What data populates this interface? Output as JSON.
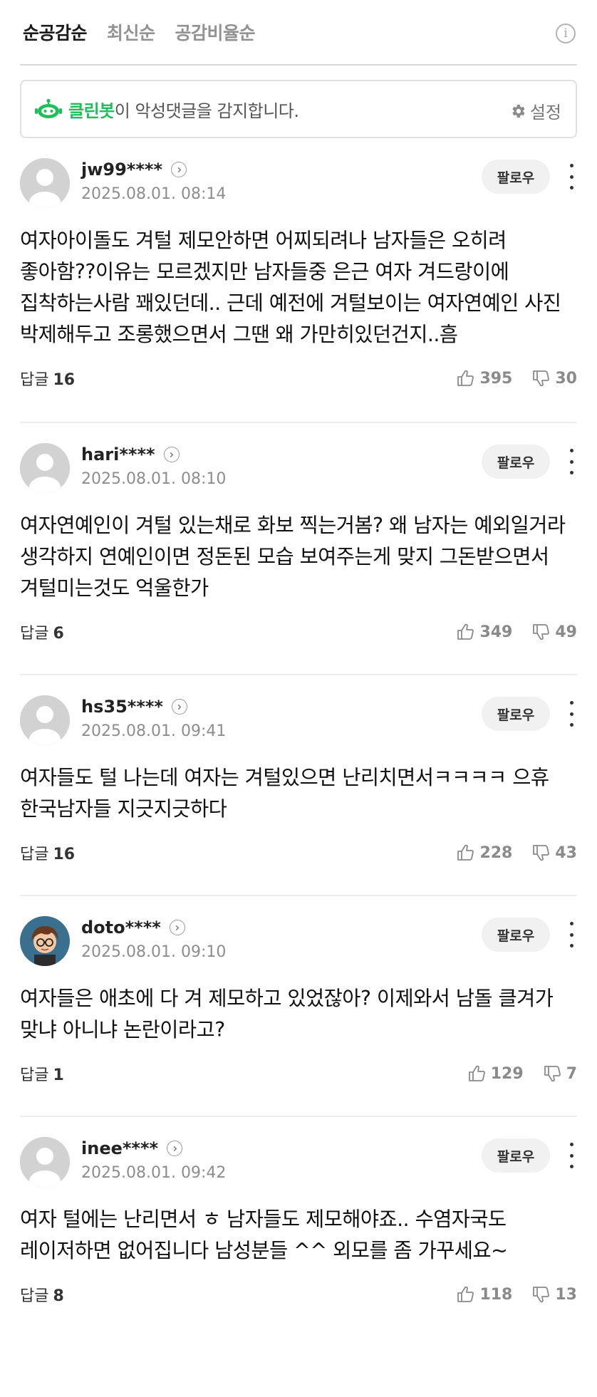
{
  "sort": {
    "tabs": [
      "순공감순",
      "최신순",
      "공감비율순"
    ],
    "active_index": 0,
    "info_icon": "info-circle-icon"
  },
  "cleanbot": {
    "name": "클린봇",
    "text": "이 악성댓글을 감지합니다.",
    "settings_label": "설정",
    "brand_color": "#1dbf5a"
  },
  "follow_label": "팔로우",
  "reply_label": "답글",
  "comments": [
    {
      "username": "jw99****",
      "date": "2025.08.01. 08:14",
      "avatar": "default",
      "body": "여자아이돌도 겨털 제모안하면 어찌되려나 남자들은 오히려 좋아함??이유는 모르겠지만 남자들중 은근 여자 겨드랑이에 집착하는사람 꽤있던데.. 근데 예전에 겨털보이는 여자연예인 사진 박제해두고 조롱했으면서 그땐 왜 가만히있던건지..흠",
      "replies": "16",
      "likes": "395",
      "dislikes": "30"
    },
    {
      "username": "hari****",
      "date": "2025.08.01. 08:10",
      "avatar": "default",
      "body": "여자연예인이 겨털 있는채로 화보 찍는거봄? 왜 남자는 예외일거라 생각하지 연예인이면 정돈된 모습 보여주는게 맞지 그돈받으면서 겨털미는것도 억울한가",
      "replies": "6",
      "likes": "349",
      "dislikes": "49"
    },
    {
      "username": "hs35****",
      "date": "2025.08.01. 09:41",
      "avatar": "default",
      "body": "여자들도 털 나는데 여자는 겨털있으면 난리치면서ㅋㅋㅋㅋ 으휴 한국남자들 지긋지긋하다",
      "replies": "16",
      "likes": "228",
      "dislikes": "43"
    },
    {
      "username": "doto****",
      "date": "2025.08.01. 09:10",
      "avatar": "character",
      "body": "여자들은 애초에 다 겨 제모하고 있었잖아? 이제와서 남돌 클겨가 맞냐 아니냐 논란이라고?",
      "replies": "1",
      "likes": "129",
      "dislikes": "7"
    },
    {
      "username": "inee****",
      "date": "2025.08.01. 09:42",
      "avatar": "default",
      "body": "여자 털에는 난리면서 ㅎ 남자들도 제모해야죠.. 수염자국도 레이저하면 없어집니다 남성분들 ^^ 외모를 좀 가꾸세요~",
      "replies": "8",
      "likes": "118",
      "dislikes": "13"
    }
  ]
}
